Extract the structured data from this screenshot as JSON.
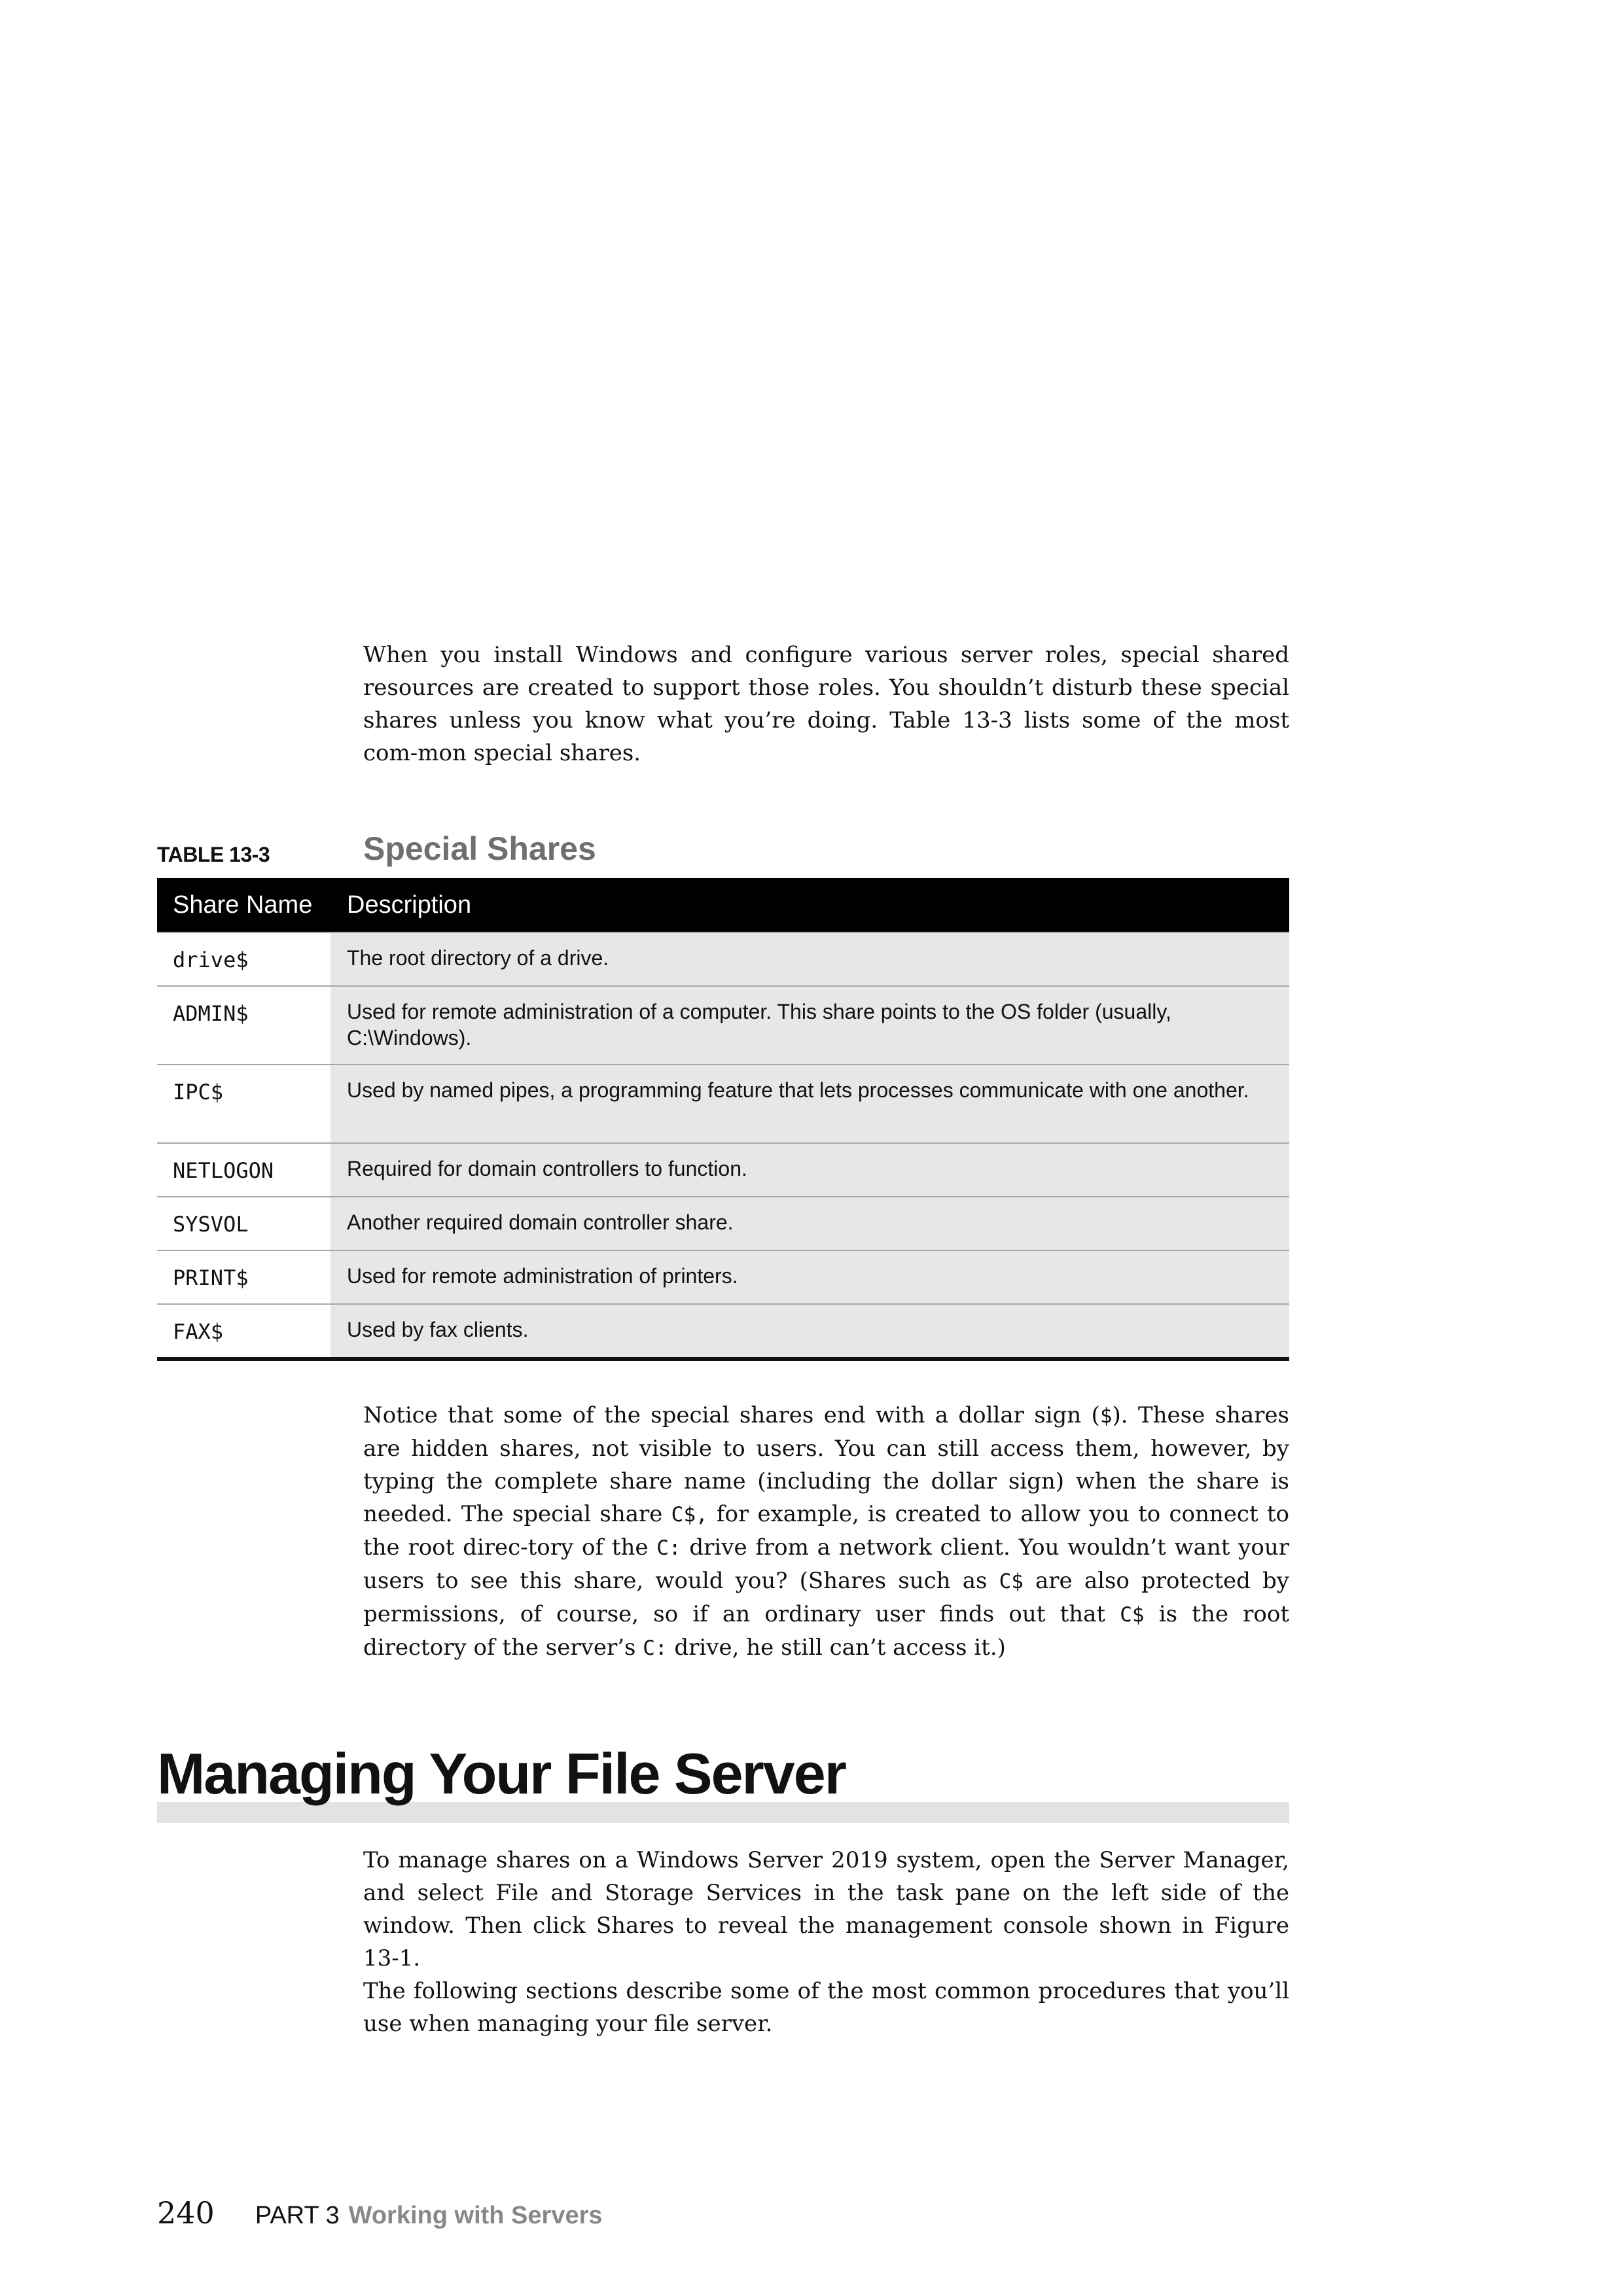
{
  "intro_paragraph": "When you install Windows and configure various server roles, special shared resources are created to support those roles. You shouldn’t disturb these special shares unless you know what you’re doing. Table 13-3 lists some of the most com-mon special shares.",
  "table": {
    "label": "TABLE 13-3",
    "title": "Special Shares",
    "headers": [
      "Share Name",
      "Description"
    ],
    "rows": [
      {
        "name": "drive$",
        "description": "The root directory of a drive."
      },
      {
        "name": "ADMIN$",
        "description": "Used for remote administration of a computer. This share points to the OS folder (usually, C:\\Windows)."
      },
      {
        "name": "IPC$",
        "description": "Used by named pipes, a programming feature that lets processes communicate with one another."
      },
      {
        "name": "NETLOGON",
        "description": "Required for domain controllers to function."
      },
      {
        "name": "SYSVOL",
        "description": "Another required domain controller share."
      },
      {
        "name": "PRINT$",
        "description": "Used for remote administration of printers."
      },
      {
        "name": "FAX$",
        "description": "Used by fax clients."
      }
    ]
  },
  "notice_paragraph": {
    "s1": "Notice that some of the special shares end with a dollar sign (",
    "c1": "$",
    "s2": "). These shares are hidden shares, not visible to users. You can still access them, however, by typing the complete share name (including the dollar sign) when the share is needed. The special share ",
    "c2": "C$,",
    "s3": " for example, is created to allow you to connect to the root direc-tory of the ",
    "c3": "C:",
    "s4": " drive from a network client. You wouldn’t want your users to see this share, would you? (Shares such as ",
    "c4": "C$",
    "s5": " are also protected by permissions, of course, so if an ordinary user finds out that ",
    "c5": "C$",
    "s6": " is the root directory of the server’s ",
    "c6": "C:",
    "s7": " drive, he still can’t access it.)"
  },
  "section_heading": "Managing Your File Server",
  "manage_paragraph_1": "To manage shares on a Windows Server 2019 system, open the Server Manager, and select File and Storage Services in the task pane on the left side of the window. Then click Shares to reveal the management console shown in Figure 13-1.",
  "manage_paragraph_2": "The following sections describe some of the most common procedures that you’ll use when managing your file server.",
  "footer": {
    "page_number": "240",
    "part_label": "PART 3",
    "part_title": "Working with Servers"
  }
}
